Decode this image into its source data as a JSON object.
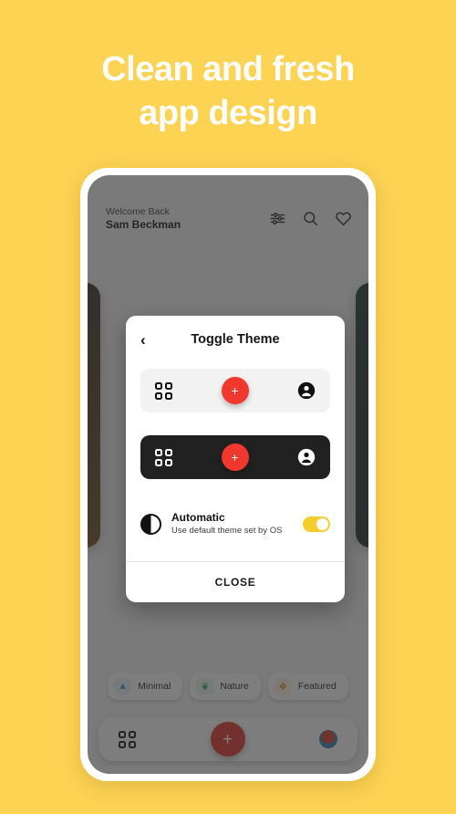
{
  "headline": {
    "line1": "Clean and fresh",
    "line2": "app design"
  },
  "colors": {
    "background": "#FDD354",
    "accent_red": "#F0382E",
    "toggle_yellow": "#F5CE2E",
    "dark_surface": "#212121",
    "light_surface": "#F2F2F2"
  },
  "app": {
    "header": {
      "greeting": "Welcome Back",
      "user_name": "Sam Beckman",
      "icons": [
        "filter-sliders-icon",
        "search-icon",
        "heart-icon"
      ]
    },
    "chips": [
      {
        "label": "Minimal",
        "icon": "mountain-icon",
        "glyph": "▲",
        "color": "#3E9BD4",
        "bg": "#E6F1FA"
      },
      {
        "label": "Nature",
        "icon": "leaf-icon",
        "glyph": "❦",
        "color": "#2E9E53",
        "bg": "#E4F4E8"
      },
      {
        "label": "Featured",
        "icon": "flame-icon",
        "glyph": "❖",
        "color": "#E4922B",
        "bg": "#FBEEDC"
      }
    ],
    "bottom_bar": {
      "grid_icon": "grid-icon",
      "add_label": "+",
      "profile_icon": "avatar-icon"
    }
  },
  "modal": {
    "back_icon": "‹",
    "title": "Toggle Theme",
    "light_preview": {
      "grid_icon": "grid-icon",
      "add_label": "+",
      "person_icon": "person-icon"
    },
    "dark_preview": {
      "grid_icon": "grid-icon",
      "add_label": "+",
      "person_icon": "person-icon"
    },
    "automatic": {
      "icon": "contrast-half-circle-icon",
      "title": "Automatic",
      "subtitle": "Use default theme set by OS",
      "toggle_state": "on"
    },
    "close_label": "CLOSE"
  }
}
